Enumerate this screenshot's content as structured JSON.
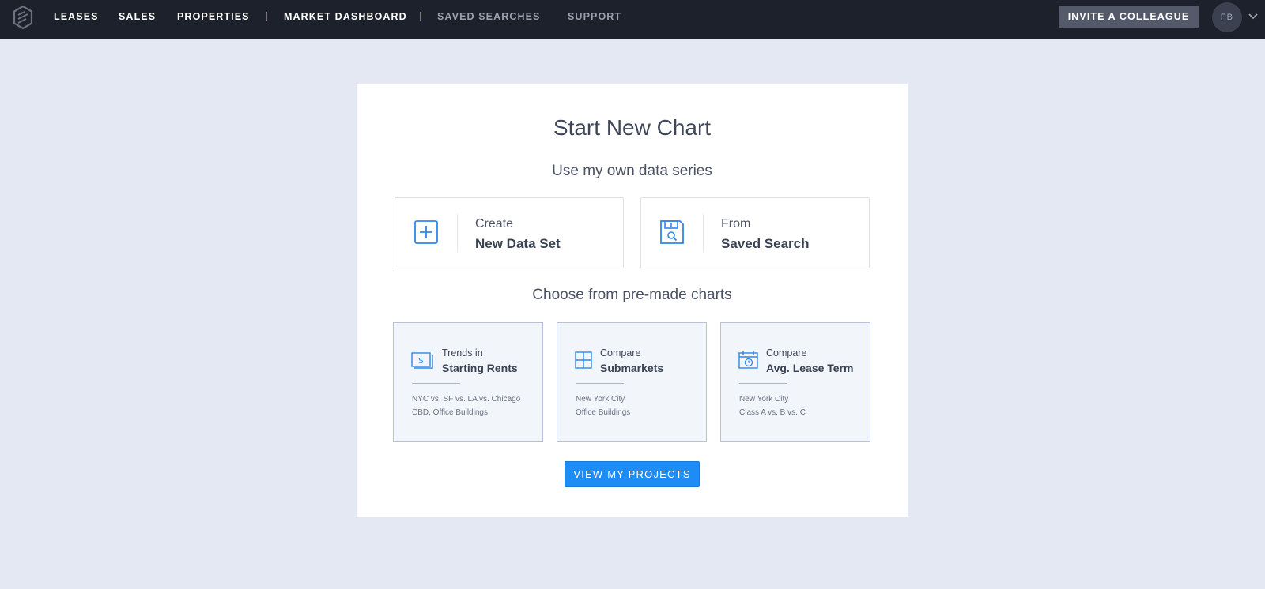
{
  "nav": {
    "items": [
      {
        "label": "LEASES"
      },
      {
        "label": "SALES"
      },
      {
        "label": "PROPERTIES"
      },
      {
        "label": "MARKET DASHBOARD"
      },
      {
        "label": "SAVED SEARCHES"
      },
      {
        "label": "SUPPORT"
      }
    ],
    "invite_label": "INVITE A COLLEAGUE",
    "avatar_initials": "FB",
    "logo_icon": "cube-logo-icon",
    "menu_icon": "chevron-down-icon"
  },
  "main": {
    "title": "Start New Chart",
    "own_data_heading": "Use my own data series",
    "options": [
      {
        "small": "Create",
        "big": "New Data Set",
        "icon": "plus-square-icon"
      },
      {
        "small": "From",
        "big": "Saved Search",
        "icon": "floppy-search-icon"
      }
    ],
    "premade_heading": "Choose from pre-made charts",
    "tiles": [
      {
        "small": "Trends in",
        "big": "Starting Rents",
        "desc1": "NYC vs. SF vs. LA vs. Chicago",
        "desc2": "CBD, Office Buildings",
        "icon": "dollar-bill-icon"
      },
      {
        "small": "Compare",
        "big": "Submarkets",
        "desc1": "New York City",
        "desc2": "Office Buildings",
        "icon": "grid-icon"
      },
      {
        "small": "Compare",
        "big": "Avg. Lease Term",
        "desc1": "New York City",
        "desc2": "Class A vs. B vs. C",
        "icon": "calendar-clock-icon"
      }
    ],
    "projects_button": "VIEW MY PROJECTS"
  },
  "colors": {
    "nav_bg": "#1c212b",
    "page_bg": "#e4e8f2",
    "accent": "#1e8cf5",
    "icon_blue": "#2f86e8"
  }
}
